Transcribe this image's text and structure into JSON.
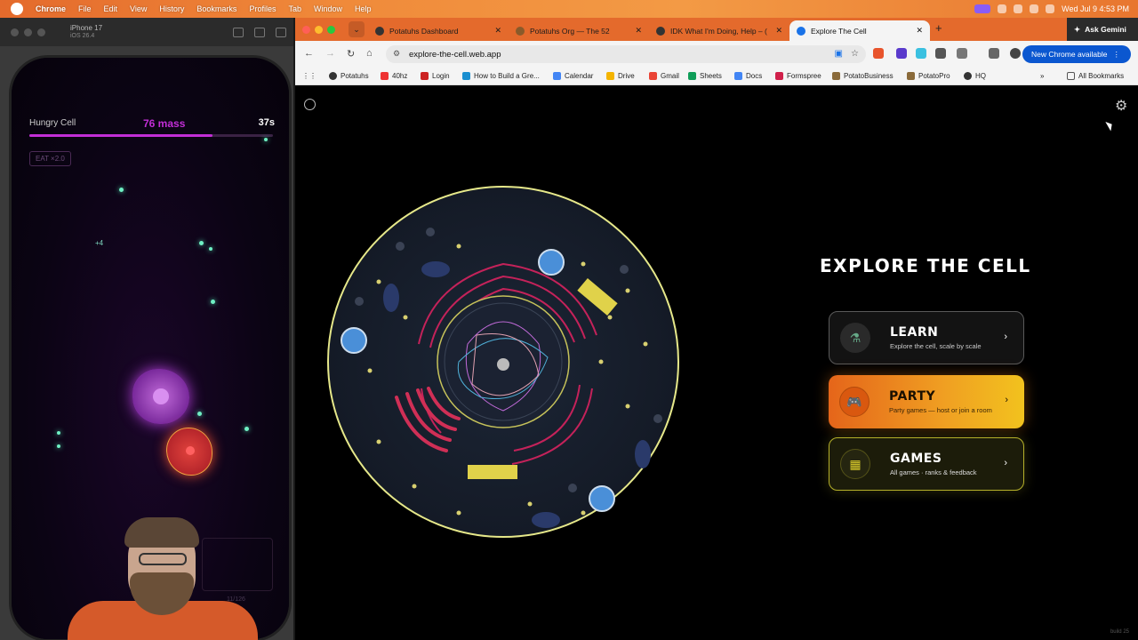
{
  "menubar": {
    "app": "Chrome",
    "items": [
      "File",
      "Edit",
      "View",
      "History",
      "Bookmarks",
      "Profiles",
      "Tab",
      "Window",
      "Help"
    ],
    "clock": "Wed Jul 9 4:53 PM"
  },
  "simulator": {
    "device": "iPhone 17",
    "os": "iOS 26.4"
  },
  "game": {
    "player_name": "Hungry Cell",
    "mass": "76 mass",
    "timer": "37s",
    "mass_progress": 0.75,
    "eat_badge": "EAT ×2.0",
    "plus": "+4",
    "counter": "11/126"
  },
  "browser": {
    "tabs": [
      {
        "title": "Potatuhs Dashboard"
      },
      {
        "title": "Potatuhs Org — The 52"
      },
      {
        "title": "IDK What I'm Doing, Help – ("
      },
      {
        "title": "Explore The Cell"
      }
    ],
    "ask_label": "Ask Gemini",
    "url": "explore-the-cell.web.app",
    "update_label": "New Chrome available",
    "bookmarks": [
      "Potatuhs",
      "40hz",
      "Login",
      "How to Build a Gre...",
      "Calendar",
      "Drive",
      "Gmail",
      "Sheets",
      "Docs",
      "Formspree",
      "PotatoBusiness",
      "PotatoPro",
      "HQ"
    ],
    "all_bookmarks": "All Bookmarks"
  },
  "page": {
    "title": "EXPLORE THE CELL",
    "buttons": [
      {
        "label": "LEARN",
        "desc": "Explore the cell, scale by scale",
        "icon": "microscope-icon"
      },
      {
        "label": "PARTY",
        "desc": "Party games — host or join a room",
        "icon": "gamepad-icon"
      },
      {
        "label": "GAMES",
        "desc": "All games · ranks & feedback",
        "icon": "grid-icon"
      }
    ],
    "build": "build 25"
  },
  "colors": {
    "accent_party": "#f0a022",
    "accent_games": "#e3d42c",
    "mass": "#c22ed6"
  }
}
